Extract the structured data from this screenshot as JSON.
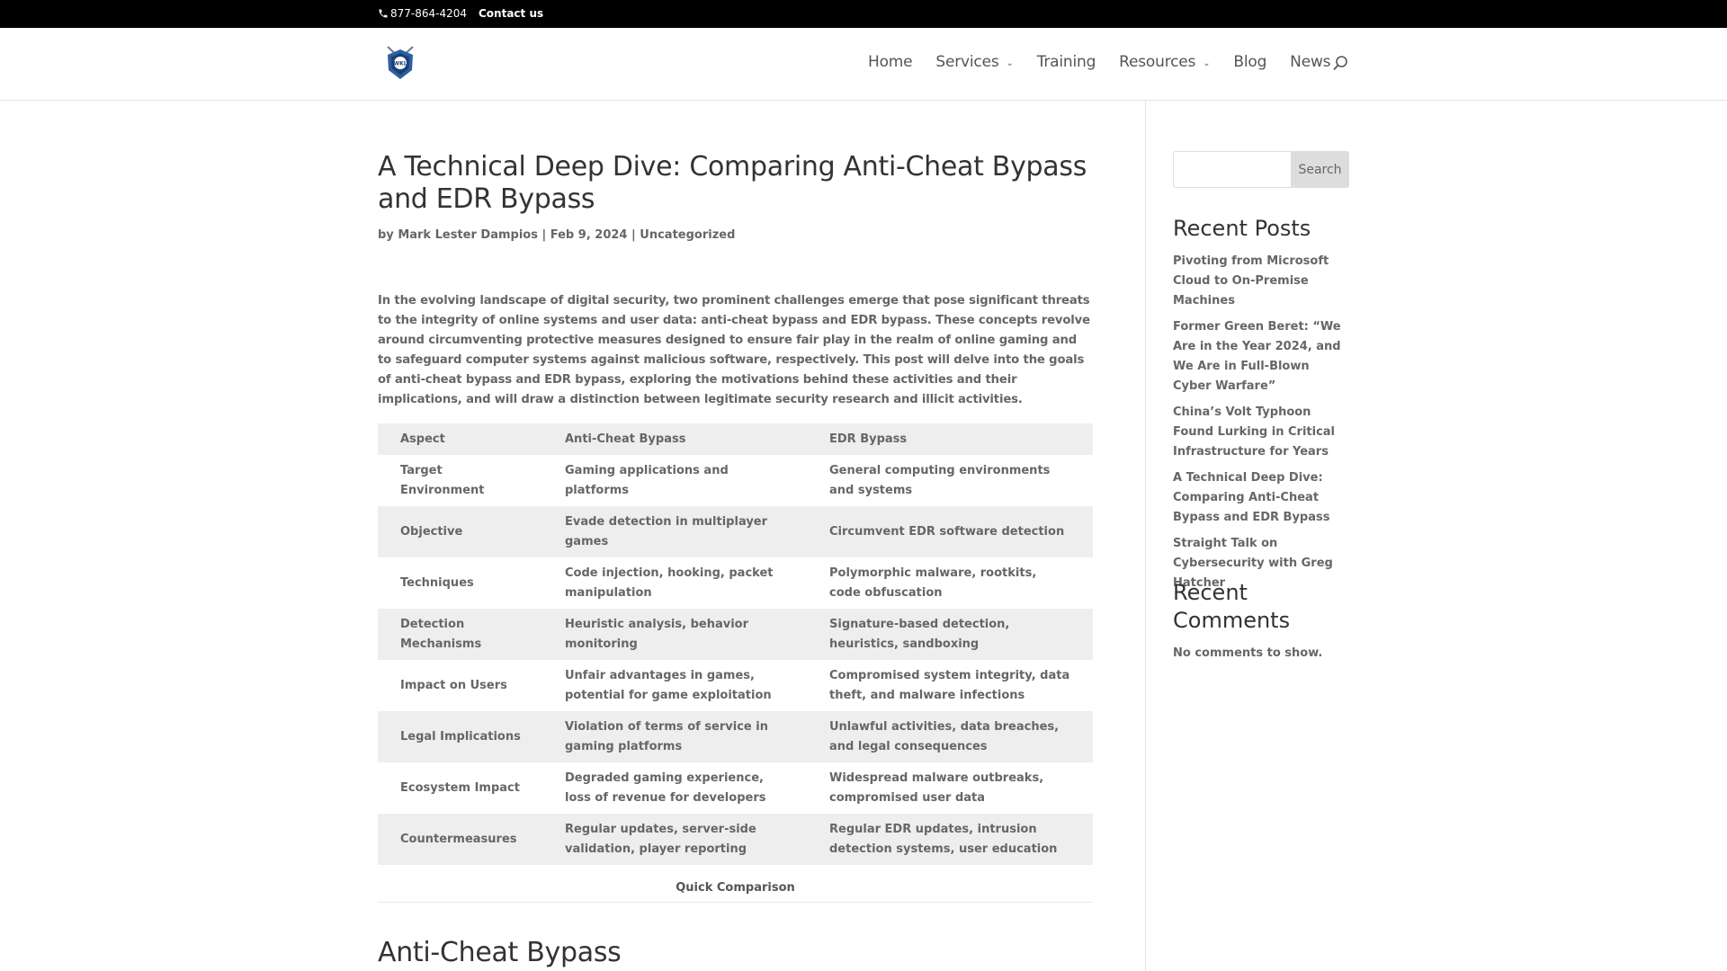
{
  "topbar": {
    "phone": "877-864-4204",
    "contact_label": "Contact us"
  },
  "header": {
    "logo_text": "WKL",
    "nav": [
      {
        "label": "Home",
        "has_dropdown": false
      },
      {
        "label": "Services",
        "has_dropdown": true
      },
      {
        "label": "Training",
        "has_dropdown": false
      },
      {
        "label": "Resources",
        "has_dropdown": true
      },
      {
        "label": "Blog",
        "has_dropdown": false
      },
      {
        "label": "News",
        "has_dropdown": false
      }
    ],
    "search_icon": "search-icon"
  },
  "post": {
    "title": "A Technical Deep Dive: Comparing Anti-Cheat Bypass and EDR Bypass",
    "meta": {
      "by": "by",
      "author": "Mark Lester Dampios",
      "separator": "|",
      "date": "Feb 9, 2024",
      "category": "Uncategorized"
    },
    "intro": "In the evolving landscape of digital security, two prominent challenges emerge that pose significant threats to the integrity of online systems and user data: anti-cheat bypass and EDR bypass. These concepts revolve around circumventing protective measures designed to ensure fair play in the realm of online gaming and to safeguard computer systems against malicious software, respectively. This post will delve into the goals of anti-cheat bypass and EDR bypass, exploring the motivations behind these activities and their implications, and will draw a distinction between legitimate security research and illicit activities.",
    "table": {
      "headers": [
        "Aspect",
        "Anti-Cheat Bypass",
        "EDR Bypass"
      ],
      "rows": [
        [
          "Target Environment",
          "Gaming applications and platforms",
          "General computing environments and systems"
        ],
        [
          "Objective",
          "Evade detection in multiplayer games",
          "Circumvent EDR software detection"
        ],
        [
          "Techniques",
          "Code injection, hooking, packet manipulation",
          "Polymorphic malware, rootkits, code obfuscation"
        ],
        [
          "Detection Mechanisms",
          "Heuristic analysis, behavior monitoring",
          "Signature-based detection, heuristics, sandboxing"
        ],
        [
          "Impact on Users",
          "Unfair advantages in games, potential for game exploitation",
          "Compromised system integrity, data theft, and malware infections"
        ],
        [
          "Legal Implications",
          "Violation of terms of service in gaming platforms",
          "Unlawful activities, data breaches, and legal consequences"
        ],
        [
          "Ecosystem Impact",
          "Degraded gaming experience, loss of revenue for developers",
          "Widespread malware outbreaks, compromised user data"
        ],
        [
          "Countermeasures",
          "Regular updates, server-side validation, player reporting",
          "Regular EDR updates, intrusion detection systems, user education"
        ]
      ],
      "caption": "Quick Comparison"
    },
    "section_heading": "Anti-Cheat Bypass"
  },
  "sidebar": {
    "search": {
      "value": "",
      "placeholder": "",
      "button_label": "Search"
    },
    "recent_posts_title": "Recent Posts",
    "recent_posts": [
      "Pivoting from Microsoft Cloud to On-Premise Machines",
      "Former Green Beret: “We Are in the Year 2024, and We Are in Full-Blown Cyber Warfare”",
      "China’s Volt Typhoon Found Lurking in Critical Infrastructure for Years",
      "A Technical Deep Dive: Comparing Anti-Cheat Bypass and EDR Bypass",
      "Straight Talk on Cybersecurity with Greg Hatcher"
    ],
    "recent_comments_title": "Recent Comments",
    "no_comments": "No comments to show."
  },
  "colors": {
    "topbar_bg": "#000000",
    "text": "#666666",
    "heading": "#333333",
    "table_stripe": "#eeeeee",
    "logo_blue": "#2b5fa3"
  }
}
